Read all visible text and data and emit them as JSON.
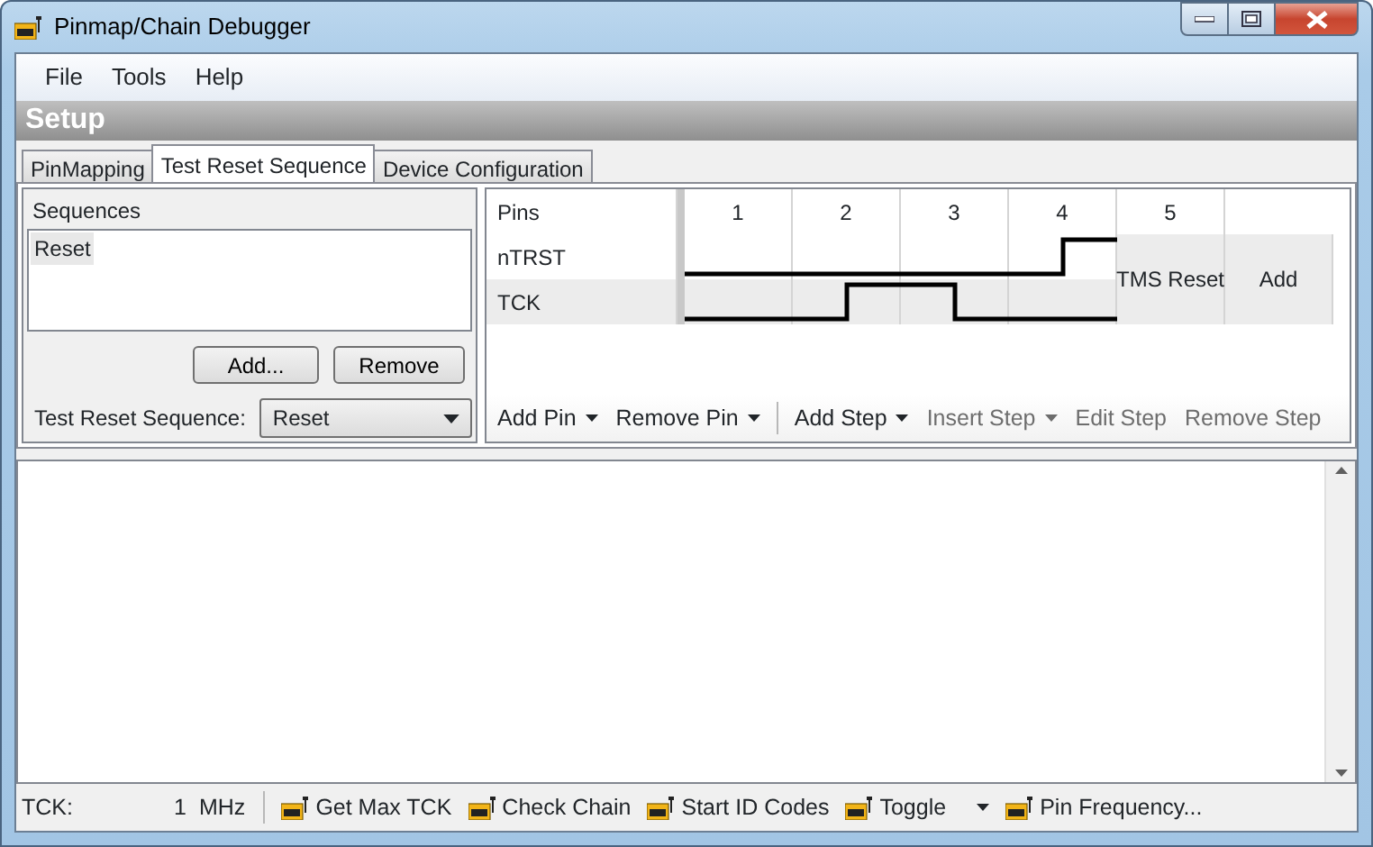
{
  "window": {
    "title": "Pinmap/Chain Debugger"
  },
  "menu": [
    "File",
    "Tools",
    "Help"
  ],
  "section_title": "Setup",
  "tabs": [
    {
      "label": "PinMapping",
      "selected": false
    },
    {
      "label": "Test Reset Sequence",
      "selected": true
    },
    {
      "label": "Device Configuration",
      "selected": false
    }
  ],
  "sequences": {
    "header": "Sequences",
    "items": [
      {
        "label": "Reset",
        "selected": true
      }
    ],
    "buttons": [
      "Add...",
      "Remove"
    ],
    "select_label": "Test Reset Sequence:",
    "select_value": "Reset"
  },
  "grid": {
    "corner": "Pins",
    "steps": [
      "1",
      "2",
      "3",
      "4",
      "5"
    ],
    "pins": [
      {
        "name": "nTRST",
        "high": [
          false,
          false,
          false,
          true
        ]
      },
      {
        "name": "TCK",
        "high": [
          false,
          true,
          false,
          false
        ]
      }
    ],
    "special_step": "TMS Reset",
    "add": "Add"
  },
  "toolbar": [
    {
      "kind": "button",
      "label": "Add Pin",
      "dropdown": true,
      "disabled": false
    },
    {
      "kind": "button",
      "label": "Remove Pin",
      "dropdown": true,
      "disabled": false
    },
    {
      "kind": "separator"
    },
    {
      "kind": "button",
      "label": "Add Step",
      "dropdown": true,
      "disabled": false
    },
    {
      "kind": "button",
      "label": "Insert Step",
      "dropdown": true,
      "disabled": true
    },
    {
      "kind": "button",
      "label": "Edit Step",
      "dropdown": false,
      "disabled": true
    },
    {
      "kind": "button",
      "label": "Remove Step",
      "dropdown": false,
      "disabled": true
    }
  ],
  "status": {
    "label": "TCK:",
    "value": "1",
    "unit": "MHz",
    "buttons": [
      {
        "label": "Get Max TCK",
        "dropdown": false
      },
      {
        "label": "Check Chain",
        "dropdown": false
      },
      {
        "label": "Start ID Codes",
        "dropdown": false
      },
      {
        "label": "Toggle",
        "dropdown": true
      },
      {
        "label": "Pin Frequency...",
        "dropdown": false
      }
    ]
  }
}
